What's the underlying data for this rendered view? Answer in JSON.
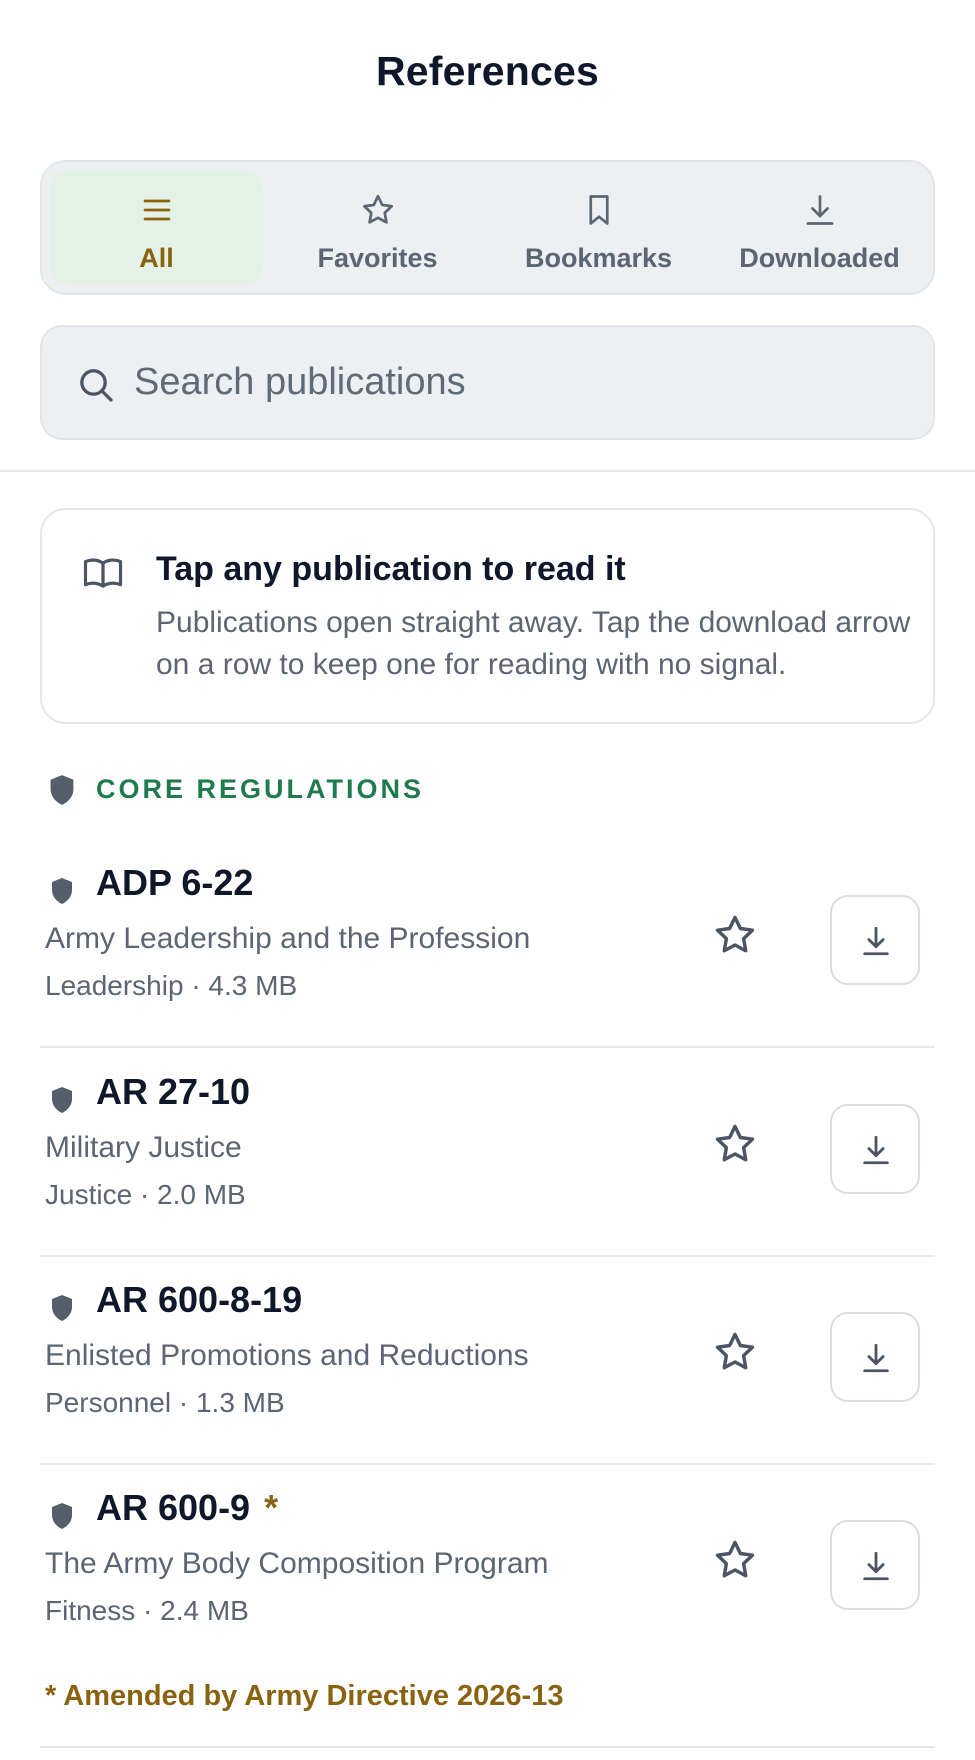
{
  "header": {
    "title": "References"
  },
  "tabs": [
    {
      "label": "All",
      "icon": "menu-icon",
      "active": true
    },
    {
      "label": "Favorites",
      "icon": "star-icon",
      "active": false
    },
    {
      "label": "Bookmarks",
      "icon": "bookmark-icon",
      "active": false
    },
    {
      "label": "Downloaded",
      "icon": "download-icon",
      "active": false
    }
  ],
  "search": {
    "placeholder": "Search publications",
    "value": ""
  },
  "tip": {
    "icon": "book-open-icon",
    "title": "Tap any publication to read it",
    "body": "Publications open straight away. Tap the download arrow on a row to keep one for reading with no signal."
  },
  "section": {
    "title": "CORE REGULATIONS",
    "icon": "shield-icon"
  },
  "publications": [
    {
      "code": "ADP 6-22",
      "amended_marker": "",
      "title": "Army Leadership and the Profession",
      "meta": "Leadership · 4.3 MB"
    },
    {
      "code": "AR 27-10",
      "amended_marker": "",
      "title": "Military Justice",
      "meta": "Justice · 2.0 MB"
    },
    {
      "code": "AR 600-8-19",
      "amended_marker": "",
      "title": "Enlisted Promotions and Reductions",
      "meta": "Personnel · 1.3 MB"
    },
    {
      "code": "AR 600-9",
      "amended_marker": "*",
      "title": "The Army Body Composition Program",
      "meta": "Fitness · 2.4 MB"
    }
  ],
  "footnote": "* Amended by Army Directive 2026-13",
  "colors": {
    "accent_gold": "#8a6311",
    "section_green": "#1f7a4d",
    "active_tab_bg": "#e4f1e6",
    "muted_text": "#5b6573",
    "surface": "#edf0f3"
  }
}
